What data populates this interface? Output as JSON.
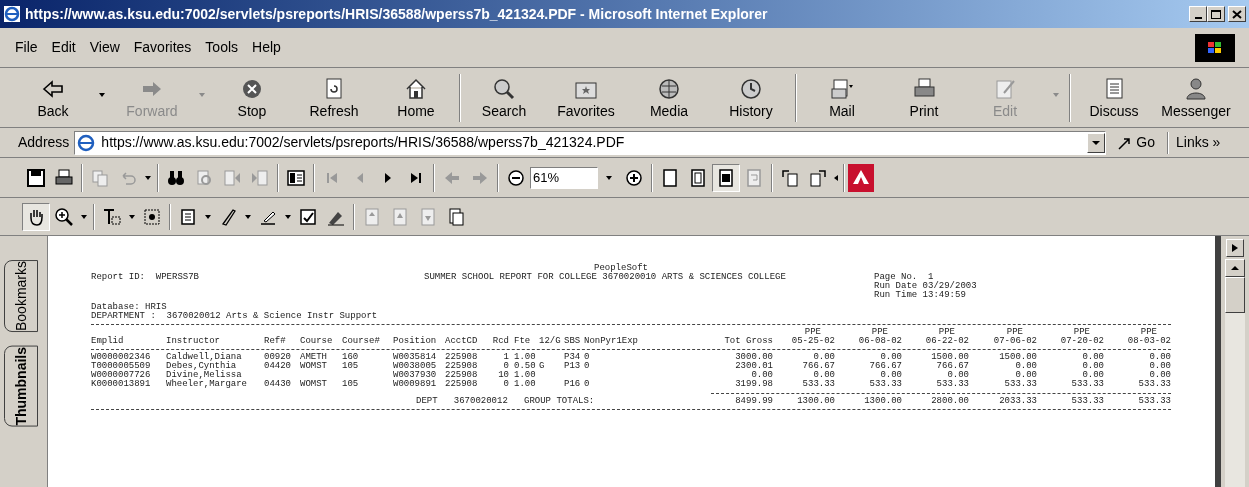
{
  "window": {
    "title": "https://www.as.ksu.edu:7002/servlets/psreports/HRIS/36588/wperss7b_421324.PDF - Microsoft Internet Explorer"
  },
  "menu": [
    "File",
    "Edit",
    "View",
    "Favorites",
    "Tools",
    "Help"
  ],
  "toolbar": [
    {
      "label": "Back",
      "disabled": false,
      "dropdown": true
    },
    {
      "label": "Forward",
      "disabled": true,
      "dropdown": true
    },
    {
      "label": "Stop",
      "disabled": false,
      "dropdown": false
    },
    {
      "label": "Refresh",
      "disabled": false,
      "dropdown": false
    },
    {
      "label": "Home",
      "disabled": false,
      "dropdown": false
    },
    {
      "label": "Search",
      "disabled": false,
      "dropdown": false
    },
    {
      "label": "Favorites",
      "disabled": false,
      "dropdown": false
    },
    {
      "label": "Media",
      "disabled": false,
      "dropdown": false
    },
    {
      "label": "History",
      "disabled": false,
      "dropdown": false
    },
    {
      "label": "Mail",
      "disabled": false,
      "dropdown": true
    },
    {
      "label": "Print",
      "disabled": false,
      "dropdown": false
    },
    {
      "label": "Edit",
      "disabled": true,
      "dropdown": true
    },
    {
      "label": "Discuss",
      "disabled": false,
      "dropdown": false
    },
    {
      "label": "Messenger",
      "disabled": false,
      "dropdown": false
    }
  ],
  "address_bar": {
    "label": "Address",
    "value": "https://www.as.ksu.edu:7002/servlets/psreports/HRIS/36588/wperss7b_421324.PDF",
    "go": "Go",
    "links": "Links »"
  },
  "pdf_toolbar": {
    "zoom": "61%",
    "fit_width_selected": true,
    "hand_tool_selected": true
  },
  "side_tabs": [
    {
      "label": "Bookmarks",
      "selected": false
    },
    {
      "label": "Thumbnails",
      "selected": true
    }
  ],
  "report": {
    "vendor": "PeopleSoft",
    "report_id": "Report ID:  WPERSS7B",
    "title": "SUMMER SCHOOL REPORT FOR COLLEGE 3670020010 ARTS & SCIENCES COLLEGE",
    "run_info": [
      "Page No.  1",
      "Run Date 03/29/2003",
      "Run Time 13:49:59"
    ],
    "database": "Database: HRIS",
    "department": "DEPARTMENT :  3670020012 Arts & Science Instr Support",
    "columns": [
      {
        "label": "Emplid"
      },
      {
        "label": "Instructor"
      },
      {
        "label": "Ref#"
      },
      {
        "label": "Course"
      },
      {
        "label": "Course#"
      },
      {
        "label": "Position"
      },
      {
        "label": "AcctCD"
      },
      {
        "label": "Rcd"
      },
      {
        "label": "Fte"
      },
      {
        "label": "12/G"
      },
      {
        "label": "SBS"
      },
      {
        "label": "NonPyr1Exp"
      },
      {
        "label": "Tot Gross"
      },
      {
        "top": "PPE",
        "label": "05-25-02"
      },
      {
        "top": "PPE",
        "label": "06-08-02"
      },
      {
        "top": "PPE",
        "label": "06-22-02"
      },
      {
        "top": "PPE",
        "label": "07-06-02"
      },
      {
        "top": "PPE",
        "label": "07-20-02"
      },
      {
        "top": "PPE",
        "label": "08-03-02"
      }
    ],
    "rows": [
      {
        "cells": [
          "W0000002346",
          "Caldwell,Diana",
          "00920",
          "AMETH",
          "160",
          "W0035814",
          "225908",
          "1",
          "1.00",
          null,
          "P34",
          "0",
          "3000.00",
          "0.00",
          "0.00",
          "1500.00",
          "1500.00",
          "0.00",
          "0.00"
        ]
      },
      {
        "cells": [
          "T0000005509",
          "Debes,Cynthia",
          "04420",
          "WOMST",
          "105",
          "W0038005",
          "225908",
          "0",
          "0.50",
          "G",
          "P13",
          "0",
          "2300.01",
          "766.67",
          "766.67",
          "766.67",
          "0.00",
          "0.00",
          "0.00"
        ]
      },
      {
        "cells": [
          "W0000007726",
          "Divine,Melissa",
          null,
          null,
          null,
          "W0037930",
          "225908",
          "10",
          "1.00",
          null,
          null,
          null,
          "0.00",
          "0.00",
          "0.00",
          "0.00",
          "0.00",
          "0.00",
          "0.00"
        ]
      },
      {
        "cells": [
          "K0000013891",
          "Wheeler,Margare",
          "04430",
          "WOMST",
          "105",
          "W0009891",
          "225908",
          "0",
          "1.00",
          null,
          "P16",
          "0",
          "3199.98",
          "533.33",
          "533.33",
          "533.33",
          "533.33",
          "533.33",
          "533.33"
        ]
      }
    ],
    "totals": {
      "label": "DEPT   3670020012   GROUP TOTALS:",
      "values": [
        "8499.99",
        "1300.00",
        "1300.00",
        "2800.00",
        "2033.33",
        "533.33",
        "533.33"
      ]
    }
  }
}
